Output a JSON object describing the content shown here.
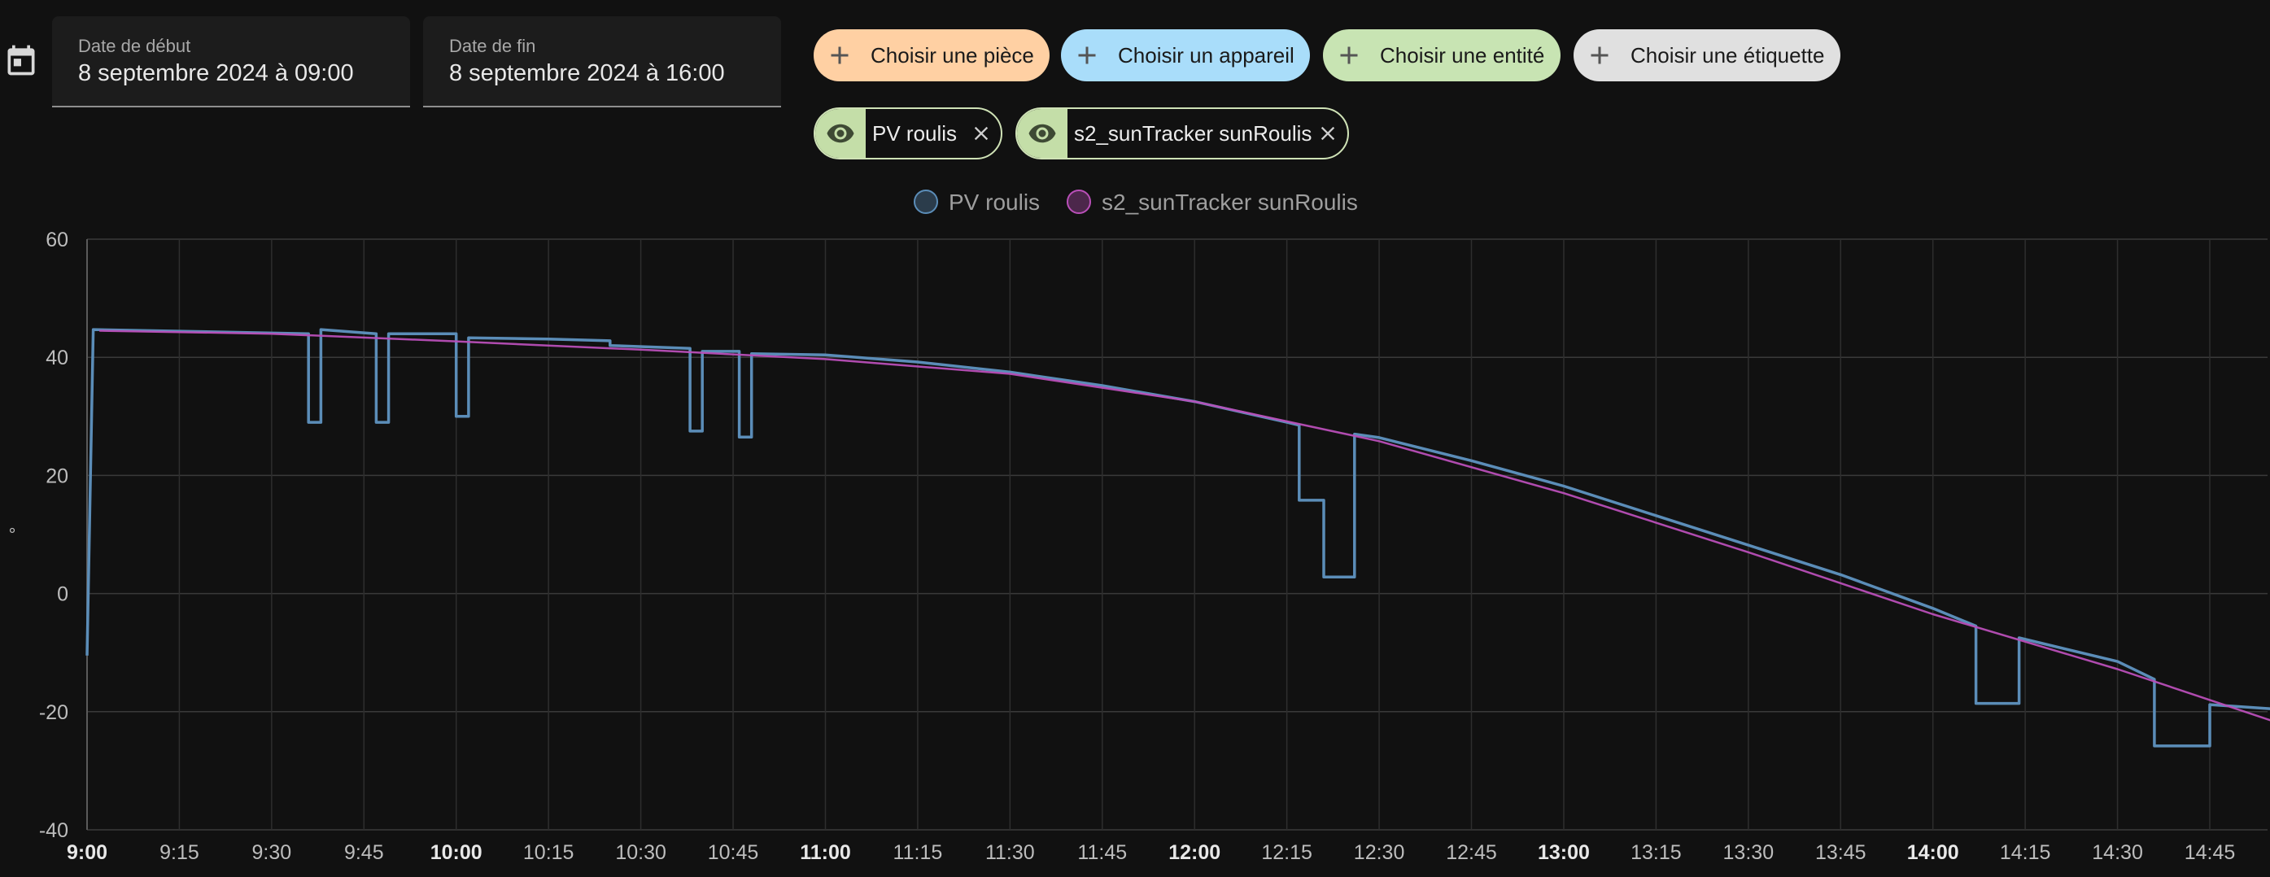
{
  "filters": {
    "start_date": {
      "label": "Date de début",
      "value": "8 septembre 2024 à 09:00"
    },
    "end_date": {
      "label": "Date de fin",
      "value": "8 septembre 2024 à 16:00"
    }
  },
  "pickers": [
    {
      "label": "Choisir une pièce",
      "color": "#ffd0a3"
    },
    {
      "label": "Choisir un appareil",
      "color": "#a9ddfa"
    },
    {
      "label": "Choisir une entité",
      "color": "#c8e4b3"
    },
    {
      "label": "Choisir une étiquette",
      "color": "#e0e0e0"
    }
  ],
  "selected_entities": [
    "PV roulis",
    "s2_sunTracker sunRoulis"
  ],
  "chart_data": {
    "type": "line",
    "ylabel": "°",
    "ylim": [
      -40,
      60
    ],
    "yticks": [
      60,
      40,
      20,
      0,
      -20,
      -40
    ],
    "grid": true,
    "legend_position": "top",
    "x_start": "9:00",
    "x_end": "14:55",
    "xticks": [
      {
        "label": "9:00",
        "bold": true
      },
      {
        "label": "9:15",
        "bold": false
      },
      {
        "label": "9:30",
        "bold": false
      },
      {
        "label": "9:45",
        "bold": false
      },
      {
        "label": "10:00",
        "bold": true
      },
      {
        "label": "10:15",
        "bold": false
      },
      {
        "label": "10:30",
        "bold": false
      },
      {
        "label": "10:45",
        "bold": false
      },
      {
        "label": "11:00",
        "bold": true
      },
      {
        "label": "11:15",
        "bold": false
      },
      {
        "label": "11:30",
        "bold": false
      },
      {
        "label": "11:45",
        "bold": false
      },
      {
        "label": "12:00",
        "bold": true
      },
      {
        "label": "12:15",
        "bold": false
      },
      {
        "label": "12:30",
        "bold": false
      },
      {
        "label": "12:45",
        "bold": false
      },
      {
        "label": "13:00",
        "bold": true
      },
      {
        "label": "13:15",
        "bold": false
      },
      {
        "label": "13:30",
        "bold": false
      },
      {
        "label": "13:45",
        "bold": false
      },
      {
        "label": "14:00",
        "bold": true
      },
      {
        "label": "14:15",
        "bold": false
      },
      {
        "label": "14:30",
        "bold": false
      },
      {
        "label": "14:45",
        "bold": false
      }
    ],
    "series": [
      {
        "name": "PV roulis",
        "color": "#5b8db8",
        "step": true,
        "points": [
          [
            "9:00",
            -10.5
          ],
          [
            "9:01",
            44.7
          ],
          [
            "9:36",
            44.0
          ],
          [
            "9:36",
            29.0
          ],
          [
            "9:38",
            29.0
          ],
          [
            "9:38",
            44.7
          ],
          [
            "9:47",
            44.0
          ],
          [
            "9:47",
            29.0
          ],
          [
            "9:49",
            29.0
          ],
          [
            "9:49",
            44.0
          ],
          [
            "10:00",
            44.0
          ],
          [
            "10:00",
            30.0
          ],
          [
            "10:02",
            30.0
          ],
          [
            "10:02",
            43.3
          ],
          [
            "10:15",
            43.1
          ],
          [
            "10:25",
            42.8
          ],
          [
            "10:25",
            42.0
          ],
          [
            "10:38",
            41.5
          ],
          [
            "10:38",
            27.5
          ],
          [
            "10:40",
            27.5
          ],
          [
            "10:40",
            41.0
          ],
          [
            "10:46",
            41.0
          ],
          [
            "10:46",
            26.5
          ],
          [
            "10:48",
            26.5
          ],
          [
            "10:48",
            40.6
          ],
          [
            "11:00",
            40.4
          ],
          [
            "11:15",
            39.2
          ],
          [
            "11:30",
            37.5
          ],
          [
            "11:45",
            35.2
          ],
          [
            "12:00",
            32.5
          ],
          [
            "12:15",
            29.0
          ],
          [
            "12:17",
            28.5
          ],
          [
            "12:17",
            15.8
          ],
          [
            "12:21",
            15.8
          ],
          [
            "12:21",
            2.8
          ],
          [
            "12:26",
            2.8
          ],
          [
            "12:26",
            27.0
          ],
          [
            "12:30",
            26.4
          ],
          [
            "12:45",
            22.5
          ],
          [
            "13:00",
            18.2
          ],
          [
            "13:15",
            13.2
          ],
          [
            "13:30",
            8.2
          ],
          [
            "13:45",
            3.2
          ],
          [
            "14:00",
            -2.5
          ],
          [
            "14:07",
            -5.5
          ],
          [
            "14:07",
            -18.6
          ],
          [
            "14:14",
            -18.6
          ],
          [
            "14:14",
            -7.5
          ],
          [
            "14:30",
            -11.5
          ],
          [
            "14:36",
            -14.5
          ],
          [
            "14:36",
            -25.8
          ],
          [
            "14:45",
            -25.8
          ],
          [
            "14:45",
            -18.8
          ],
          [
            "14:55",
            -19.5
          ]
        ]
      },
      {
        "name": "s2_sunTracker sunRoulis",
        "color": "#b94fb8",
        "step": false,
        "points": [
          [
            "9:02",
            44.5
          ],
          [
            "9:30",
            44.0
          ],
          [
            "10:00",
            42.7
          ],
          [
            "10:30",
            41.3
          ],
          [
            "11:00",
            39.7
          ],
          [
            "11:30",
            37.2
          ],
          [
            "12:00",
            32.5
          ],
          [
            "12:30",
            25.8
          ],
          [
            "13:00",
            17.0
          ],
          [
            "13:30",
            7.0
          ],
          [
            "14:00",
            -3.5
          ],
          [
            "14:30",
            -12.8
          ],
          [
            "14:55",
            -21.5
          ]
        ]
      }
    ]
  }
}
